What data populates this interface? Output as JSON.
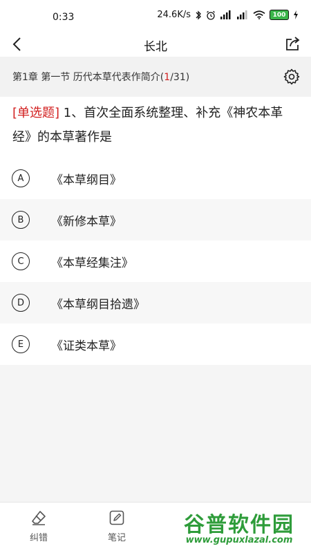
{
  "status_bar": {
    "time": "0:33",
    "net_speed": "24.6K/s",
    "battery": "100"
  },
  "nav": {
    "title": "长北"
  },
  "chapter": {
    "prefix": "第1章 第一节 历代本草代表作简介(",
    "current": "1",
    "suffix": "/31)"
  },
  "question": {
    "type_label": "[单选题]",
    "text": " 1、首次全面系统整理、补充《神农本革经》的本草著作是"
  },
  "options": [
    {
      "letter": "A",
      "text": "《本草纲目》"
    },
    {
      "letter": "B",
      "text": "《新修本草》"
    },
    {
      "letter": "C",
      "text": "《本草经集注》"
    },
    {
      "letter": "D",
      "text": "《本草纲目拾遗》"
    },
    {
      "letter": "E",
      "text": "《证类本草》"
    }
  ],
  "bottom_tabs": {
    "correct_label": "纠错",
    "note_label": "笔记"
  },
  "watermark": {
    "title": "谷普软件园",
    "url": "www.gupuxlazal.com"
  }
}
